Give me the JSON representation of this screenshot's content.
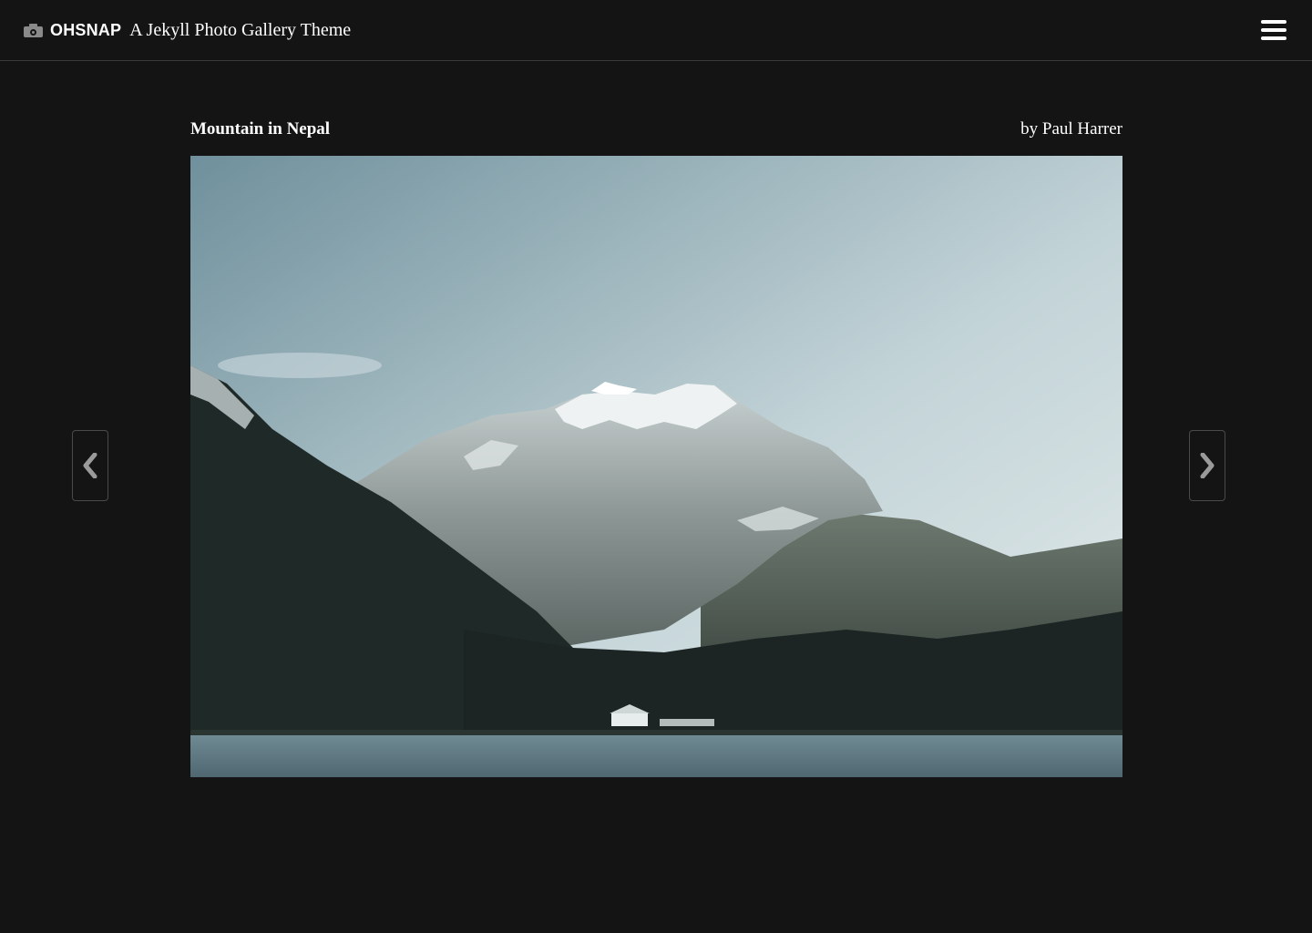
{
  "header": {
    "brand_name": "OHSNAP",
    "tagline": "A Jekyll Photo Gallery Theme",
    "brand_icon": "camera-icon",
    "menu_icon": "hamburger-menu-icon"
  },
  "photo": {
    "title": "Mountain in Nepal",
    "credit": "by Paul Harrer",
    "alt": "Snow-capped mountain above a forested valley and lake"
  },
  "navigation": {
    "prev_icon": "chevron-left-icon",
    "next_icon": "chevron-right-icon"
  },
  "colors": {
    "background": "#141414",
    "text": "#ffffff",
    "border": "#3a3a3a",
    "arrow": "#9a9a9a"
  }
}
